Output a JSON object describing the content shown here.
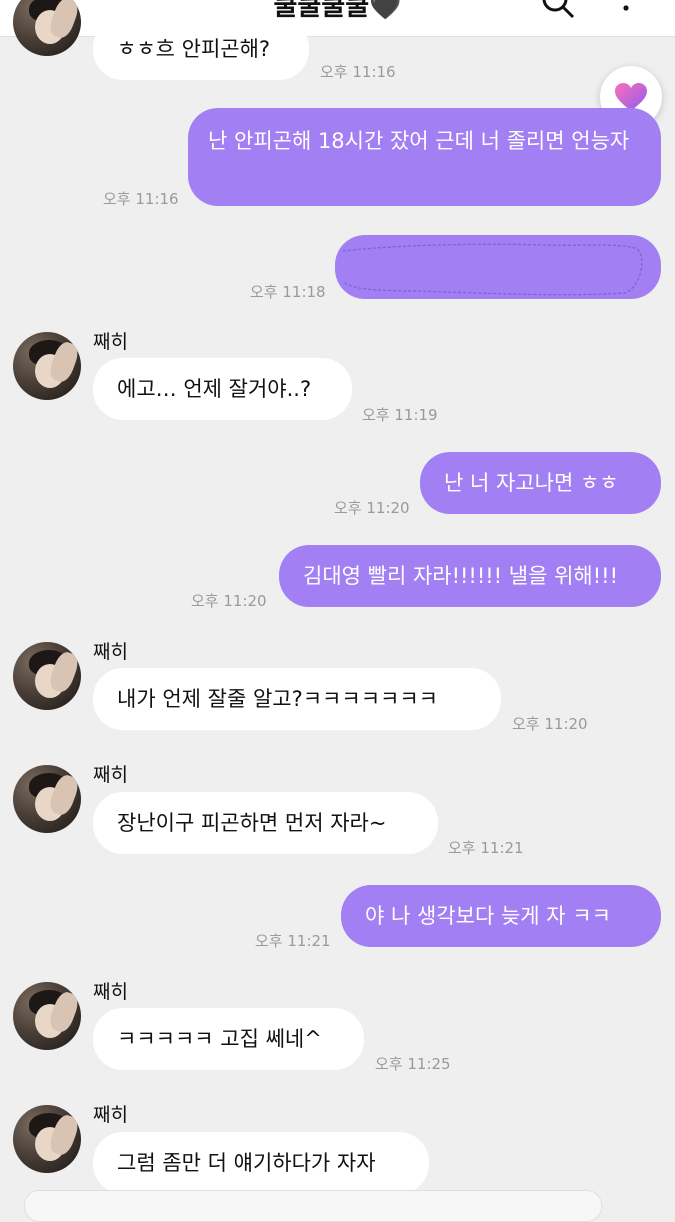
{
  "header": {
    "title": "쿨쿨쿨쿨🖤",
    "back_icon": "chevron-left-icon",
    "search_icon": "search-icon",
    "more_icon": "more-vertical-icon"
  },
  "colors": {
    "outgoing_bubble": "#a27ff3",
    "incoming_bubble": "#ffffff",
    "background": "#efeff0"
  },
  "floating_button": {
    "icon": "heart-icon"
  },
  "messages": [
    {
      "dir": "in",
      "sender": "",
      "text": "ㅎㅎ흐 안피곤해?",
      "time": "오후 11:16"
    },
    {
      "dir": "out",
      "text": "난 안피곤해 18시간 잤어 근데 너 졸리면 언능자",
      "time": "오후 11:16"
    },
    {
      "dir": "out",
      "text": "",
      "time": "오후 11:18",
      "redacted": true
    },
    {
      "dir": "in",
      "sender": "째히",
      "text": "에고… 언제 잘거야..?",
      "time": "오후 11:19"
    },
    {
      "dir": "out",
      "text": "난 너 자고나면 ㅎㅎ",
      "time": "오후 11:20"
    },
    {
      "dir": "out",
      "text": "김대영 빨리 자라!!!!!! 낼을 위해!!!",
      "time": "오후 11:20"
    },
    {
      "dir": "in",
      "sender": "째히",
      "text": "내가 언제 잘줄 알고?ㅋㅋㅋㅋㅋㅋㅋ",
      "time": "오후 11:20"
    },
    {
      "dir": "in",
      "sender": "째히",
      "text": "장난이구 피곤하면 먼저 자라~",
      "time": "오후 11:21"
    },
    {
      "dir": "out",
      "text": "야 나 생각보다 늦게 자 ㅋㅋ",
      "time": "오후 11:21"
    },
    {
      "dir": "in",
      "sender": "째히",
      "text": "ㅋㅋㅋㅋㅋ 고집 쎄네^",
      "time": "오후 11:25"
    },
    {
      "dir": "in",
      "sender": "째히",
      "text": "그럼 좀만 더 얘기하다가 자자",
      "time": ""
    }
  ]
}
